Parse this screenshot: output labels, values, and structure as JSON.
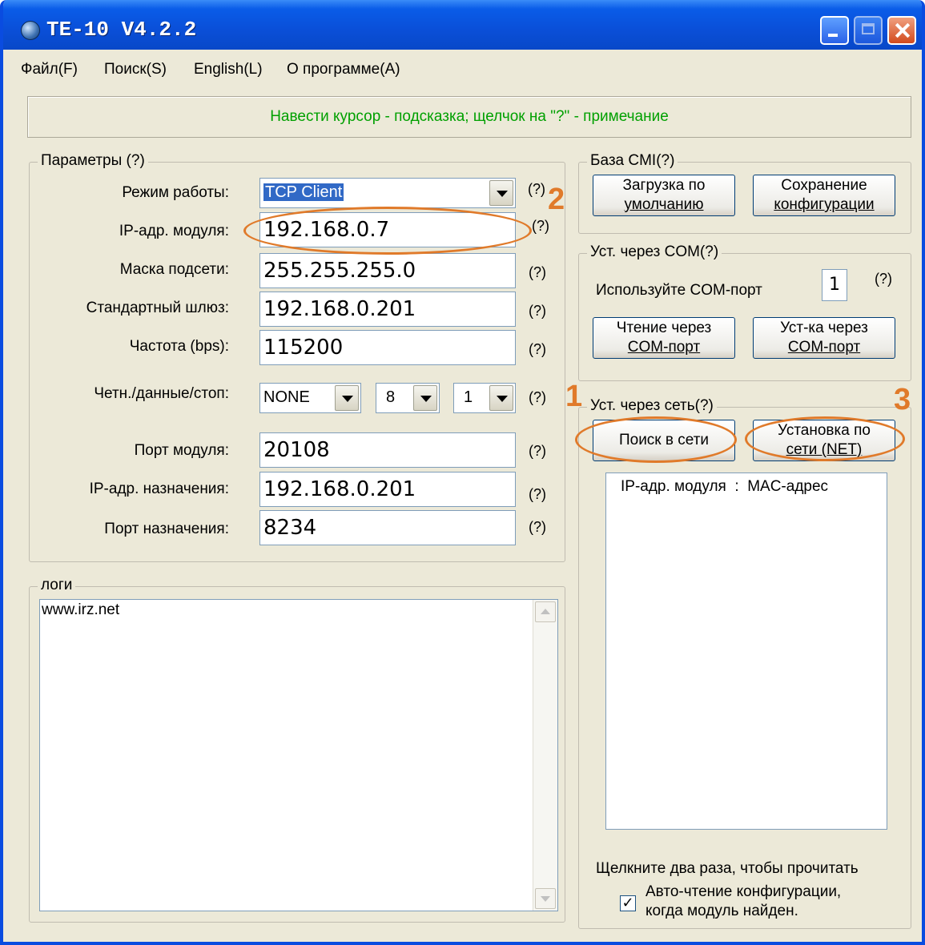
{
  "window": {
    "title": "TE-10 V4.2.2"
  },
  "menu": {
    "file": "Файл(F)",
    "search": "Поиск(S)",
    "english": "English(L)",
    "about": "О программе(A)"
  },
  "hint": "Навести курсор - подсказка; щелчок на \"?\" - примечание",
  "params": {
    "group_label": "Параметры (?)",
    "mode_label": "Режим работы:",
    "mode_value": "TCP Client",
    "ip_label": "IP-адр. модуля:",
    "ip_value": "192.168.0.7",
    "mask_label": "Маска подсети:",
    "mask_value": "255.255.255.0",
    "gateway_label": "Стандартный шлюз:",
    "gateway_value": "192.168.0.201",
    "baud_label": "Частота (bps):",
    "baud_value": "115200",
    "parity_label": "Четн./данные/стоп:",
    "parity_value": "NONE",
    "data_value": "8",
    "stop_value": "1",
    "port_label": "Порт модуля:",
    "port_value": "20108",
    "dest_ip_label": "IP-адр. назначения:",
    "dest_ip_value": "192.168.0.201",
    "dest_port_label": "Порт назначения:",
    "dest_port_value": "8234",
    "help": "(?)"
  },
  "logs": {
    "group_label": "логи",
    "text": "www.irz.net"
  },
  "cmi": {
    "group_label": "База CMI(?)",
    "load_default": [
      "Загрузка по",
      "умолчанию"
    ],
    "save_config": [
      "Сохранение",
      "конфигурации"
    ]
  },
  "com": {
    "group_label": "Уст. через COM(?)",
    "use_port": "Используйте COM-порт",
    "port_number": "1",
    "help": "(?)",
    "read_button": [
      "Чтение через",
      "COM-порт"
    ],
    "set_button": [
      "Уст-ка через",
      "COM-порт"
    ]
  },
  "net": {
    "group_label": "Уст. через сеть(?)",
    "search_button": "Поиск в сети",
    "set_button": [
      "Установка по",
      "сети (NET)"
    ],
    "list_header": "IP-адр. модуля  :  MAC-адрес",
    "double_click_hint": "Щелкните два раза, чтобы прочитать",
    "auto_read": [
      "Авто-чтение конфигурации,",
      "когда модуль найден."
    ],
    "auto_read_checked": true
  },
  "callouts": {
    "one": "1",
    "two": "2",
    "three": "3"
  },
  "colors": {
    "accent_orange": "#e07a2a",
    "hint_green": "#00a000"
  }
}
